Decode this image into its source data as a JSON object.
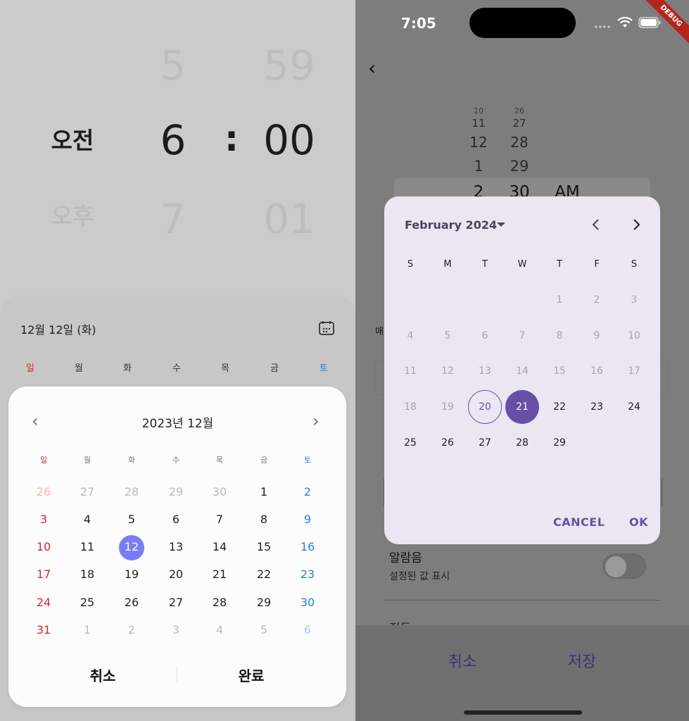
{
  "left": {
    "time_picker": {
      "ampm_selected": "오전",
      "ampm_next": "오후",
      "hour_prev": "5",
      "hour_selected": "6",
      "hour_next": "7",
      "separator": ":",
      "minute_prev": "59",
      "minute_selected": "00",
      "minute_next": "01"
    },
    "sheet": {
      "date_text": "12월 12일 (화)",
      "calendar_icon": "calendar-icon",
      "weekdays": [
        "일",
        "월",
        "화",
        "수",
        "목",
        "금",
        "토"
      ]
    },
    "calendar": {
      "prev_icon": "‹",
      "next_icon": "›",
      "title": "2023년 12월",
      "weekdays": [
        "일",
        "월",
        "화",
        "수",
        "목",
        "금",
        "토"
      ],
      "weeks": [
        [
          "26",
          "27",
          "28",
          "29",
          "30",
          "1",
          "2"
        ],
        [
          "3",
          "4",
          "5",
          "6",
          "7",
          "8",
          "9"
        ],
        [
          "10",
          "11",
          "12",
          "13",
          "14",
          "15",
          "16"
        ],
        [
          "17",
          "18",
          "19",
          "20",
          "21",
          "22",
          "23"
        ],
        [
          "24",
          "25",
          "26",
          "27",
          "28",
          "29",
          "30"
        ],
        [
          "31",
          "1",
          "2",
          "3",
          "4",
          "5",
          "6"
        ]
      ],
      "selected_day": "12",
      "cancel_label": "취소",
      "done_label": "완료"
    },
    "colors": {
      "sunday": "#cf2b2b",
      "saturday": "#2a7fd3",
      "selected": "#7b7cf5"
    }
  },
  "right": {
    "status_bar": {
      "time": "7:05",
      "debug_banner": "DEBUG"
    },
    "back_icon": "‹",
    "background_picker": {
      "hours": [
        "10",
        "11",
        "12",
        "1",
        "2"
      ],
      "minutes": [
        "26",
        "27",
        "28",
        "29",
        "30"
      ],
      "period": "AM"
    },
    "background_label": "매",
    "alarm": {
      "label": "알람음",
      "sub": "설정된 값 표시"
    },
    "partial_label": "진동",
    "footer": {
      "cancel": "취소",
      "save": "저장"
    },
    "date_picker": {
      "month_label": "February 2024",
      "weekdays": [
        "S",
        "M",
        "T",
        "W",
        "T",
        "F",
        "S"
      ],
      "weeks": [
        [
          "",
          "",
          "",
          "",
          "1",
          "2",
          "3"
        ],
        [
          "4",
          "5",
          "6",
          "7",
          "8",
          "9",
          "10"
        ],
        [
          "11",
          "12",
          "13",
          "14",
          "15",
          "16",
          "17"
        ],
        [
          "18",
          "19",
          "20",
          "21",
          "22",
          "23",
          "24"
        ],
        [
          "25",
          "26",
          "27",
          "28",
          "29",
          "",
          ""
        ]
      ],
      "today": "20",
      "selected": "21",
      "cancel_label": "CANCEL",
      "ok_label": "OK"
    },
    "colors": {
      "primary": "#6750a4",
      "dialog_bg": "#ece6f3"
    }
  }
}
